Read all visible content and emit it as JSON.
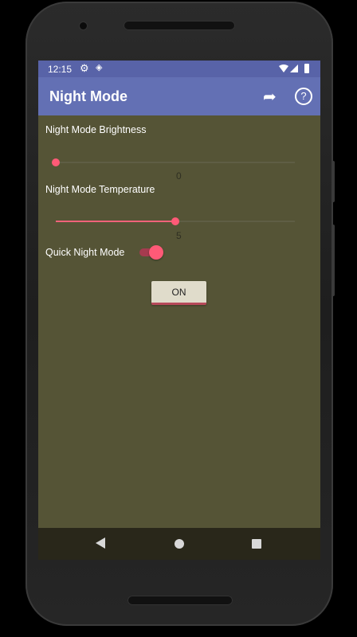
{
  "statusbar": {
    "time": "12:15",
    "settings_icon": "gear-icon",
    "app_icon": "diamond-icon",
    "wifi_icon": "wifi-icon",
    "signal_icon": "signal-icon",
    "battery_icon": "battery-icon"
  },
  "appbar": {
    "title": "Night Mode",
    "share_icon": "share-icon",
    "help_icon": "help-icon",
    "help_glyph": "?"
  },
  "settings": {
    "brightness": {
      "label": "Night Mode Brightness",
      "value": "0",
      "fraction": 0.0
    },
    "temperature": {
      "label": "Night Mode Temperature",
      "value": "5",
      "fraction": 0.5
    },
    "quick": {
      "label": "Quick Night Mode",
      "checked": true
    }
  },
  "on_button": {
    "label": "ON"
  },
  "colors": {
    "accent": "#ff5a77",
    "appbar": "#6370b4",
    "statusbar": "#5863a8",
    "background": "#555436"
  }
}
